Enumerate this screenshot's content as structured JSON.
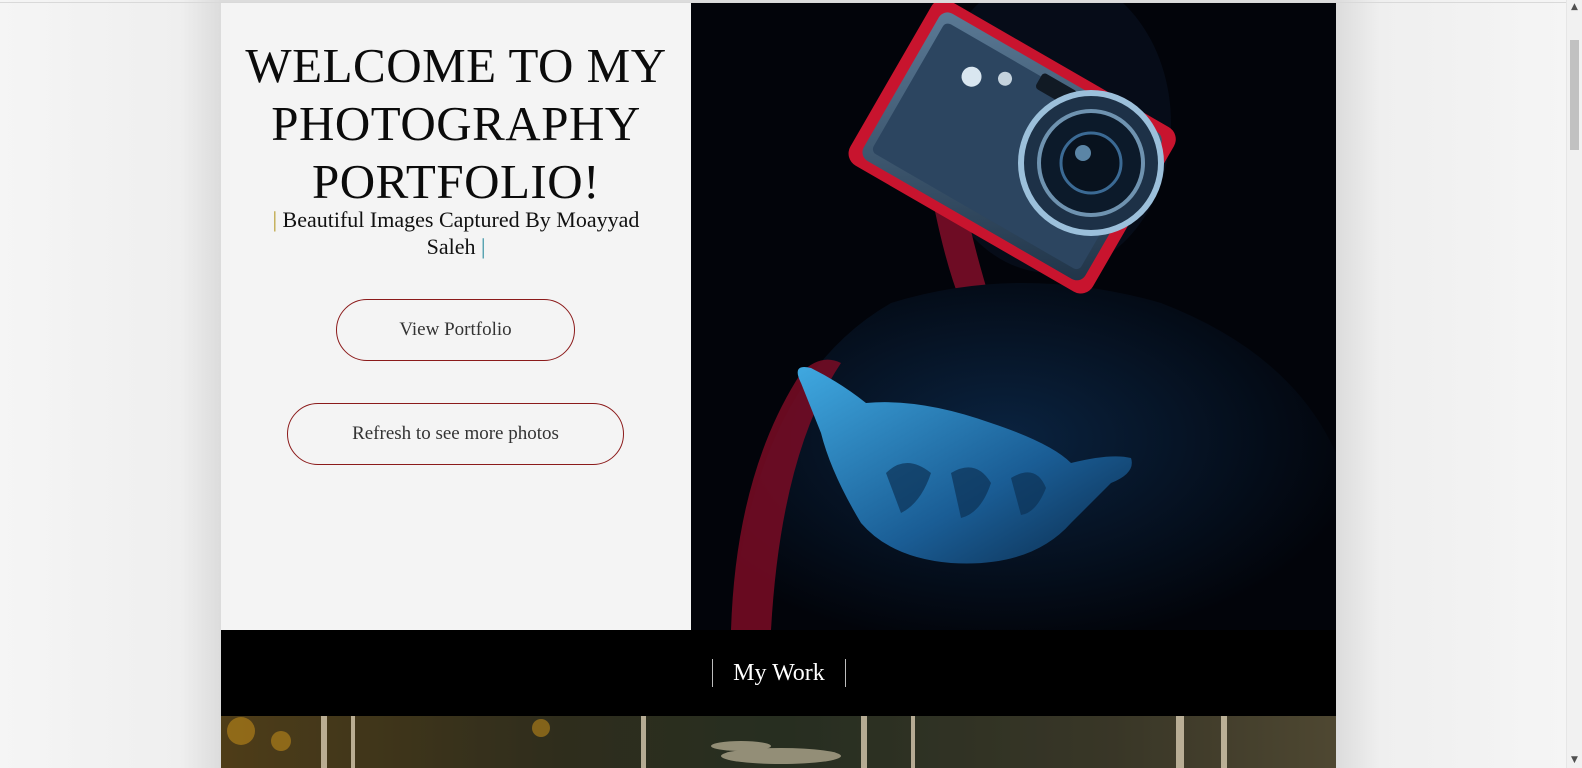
{
  "hero": {
    "title": "WELCOME TO MY PHOTOGRAPHY PORTFOLIO!",
    "subtitle_bar_left": "|",
    "subtitle_text": " Beautiful Images Captured By Moayyad Saleh ",
    "subtitle_bar_right": "|",
    "view_button": "View Portfolio",
    "refresh_button": "Refresh to see more photos",
    "photo_icon": "camera-photo"
  },
  "work_section": {
    "title": "My Work"
  },
  "colors": {
    "accent_border": "#8b1a1a",
    "background": "#f4f4f4",
    "band": "#000000"
  },
  "scrollbar": {
    "up_icon": "scroll-up-arrow",
    "down_icon": "scroll-down-arrow"
  }
}
